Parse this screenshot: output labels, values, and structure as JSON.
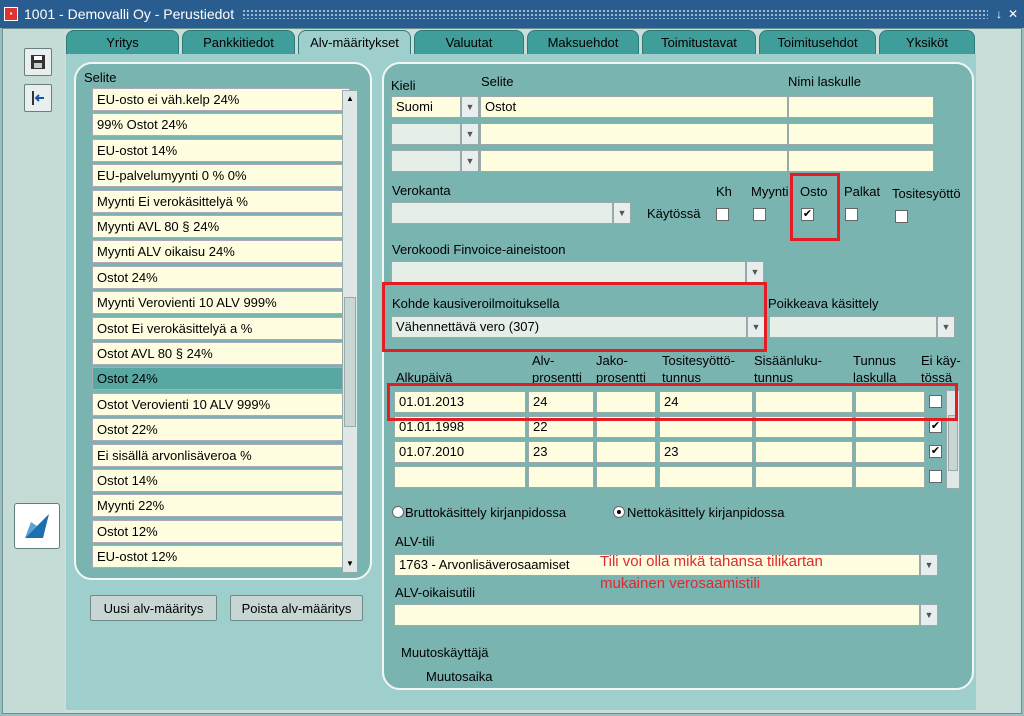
{
  "window": {
    "title": "1001 - Demovalli Oy - Perustiedot",
    "window_buttons": [
      "↓",
      "✕"
    ]
  },
  "tabs": [
    "Yritys",
    "Pankkitiedot",
    "Alv-määritykset",
    "Valuutat",
    "Maksuehdot",
    "Toimitustavat",
    "Toimitusehdot",
    "Yksiköt"
  ],
  "active_tab": "Alv-määritykset",
  "left": {
    "header": "Selite",
    "items": [
      "EU-osto  ei väh.kelp 24%",
      "99% Ostot 24%",
      "EU-ostot 14%",
      "EU-palvelumyynti 0 % 0%",
      "Myynti Ei verokäsittelyä %",
      "Myynti AVL 80 § 24%",
      "Myynti ALV  oikaisu 24%",
      "Ostot 24%",
      "Myynti Verovienti 10 ALV 999%",
      "Ostot Ei verokäsittelyä a %",
      "Ostot AVL 80 § 24%",
      "Ostot 24%",
      "Ostot Verovienti 10 ALV 999%",
      "Ostot 22%",
      "Ei sisällä arvonlisäveroa %",
      "Ostot 14%",
      "Myynti 22%",
      "Ostot 12%",
      "EU-ostot 12%"
    ],
    "selected_index": 11,
    "new_button": "Uusi alv-määritys",
    "delete_button": "Poista alv-määritys"
  },
  "detail": {
    "kieli_label": "Kieli",
    "selite_label": "Selite",
    "nimi_label": "Nimi laskulle",
    "kieli_value": "Suomi",
    "selite_value": "Ostot",
    "verokanta_label": "Verokanta",
    "kaytossa_label": "Käytössä",
    "usage": [
      {
        "label": "Kh",
        "checked": false
      },
      {
        "label": "Myynti",
        "checked": false
      },
      {
        "label": "Osto",
        "checked": true
      },
      {
        "label": "Palkat",
        "checked": false
      },
      {
        "label": "Tositesyöttö",
        "checked": false
      }
    ],
    "finvoice_label": "Verokoodi Finvoice-aineistoon",
    "kohde_label": "Kohde kausiveroilmoituksella",
    "kohde_value": "Vähennettävä vero (307)",
    "poikkeava_label": "Poikkeava käsittely",
    "grid_headers": [
      [
        "Alkupäivä"
      ],
      [
        "Alv-",
        "prosentti"
      ],
      [
        "Jako-",
        "prosentti"
      ],
      [
        "Tositesyöttö-",
        "tunnus"
      ],
      [
        "Sisäänluku-",
        "tunnus"
      ],
      [
        "Tunnus",
        "laskulla"
      ],
      [
        "Ei käy-",
        "tössä"
      ]
    ],
    "grid_rows": [
      {
        "date": "01.01.2013",
        "alv": "24",
        "jako": "",
        "tosite": "24",
        "sisaan": "",
        "tunnus": "",
        "ei": false
      },
      {
        "date": "01.01.1998",
        "alv": "22",
        "jako": "",
        "tosite": "",
        "sisaan": "",
        "tunnus": "",
        "ei": true
      },
      {
        "date": "01.07.2010",
        "alv": "23",
        "jako": "",
        "tosite": "23",
        "sisaan": "",
        "tunnus": "",
        "ei": true
      },
      {
        "date": "",
        "alv": "",
        "jako": "",
        "tosite": "",
        "sisaan": "",
        "tunnus": "",
        "ei": false
      }
    ],
    "brutto_label": "Bruttokäsittely kirjanpidossa",
    "netto_label": "Nettokäsittely kirjanpidossa",
    "netto_selected": true,
    "alv_tili_label": "ALV-tili",
    "alv_tili_value": "1763 - Arvonlisäverosaamiset",
    "oikaisutili_label": "ALV-oikaisutili",
    "muutoskayttaja_label": "Muutoskäyttäjä",
    "muutosaika_label": "Muutosaika"
  },
  "annotation": [
    "Tili voi olla mikä tahansa tilikartan",
    "mukainen verosaamistili"
  ],
  "colors": {
    "highlight_red": "#e41c24",
    "annotation_red": "#e0282f",
    "panel": "#9fcfcc",
    "card": "#79b4b0",
    "field": "#fffde0"
  }
}
